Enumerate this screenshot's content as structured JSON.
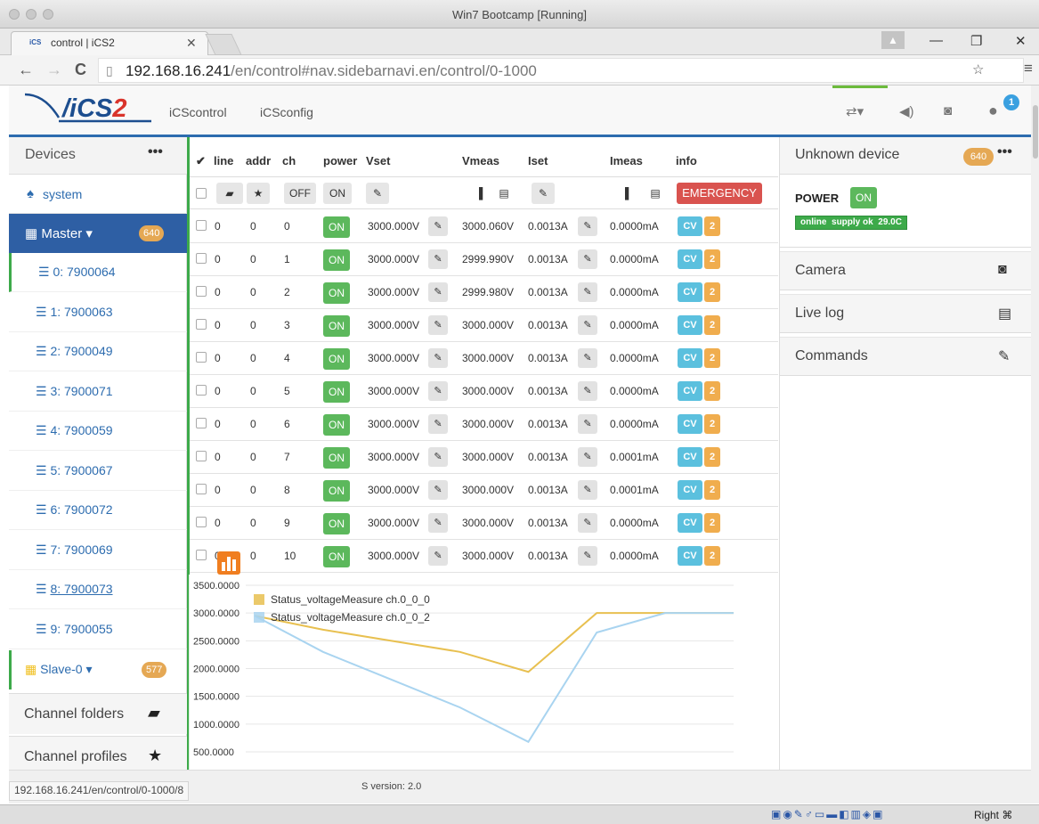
{
  "window": {
    "title": "Win7 Bootcamp [Running]"
  },
  "browser": {
    "tab_title": "control | iCS2",
    "tab_favicon": "ics2-favicon",
    "url_host": "192.168.16.241",
    "url_rest": "/en/control#nav.sidebarnavi.en/control/0-1000",
    "status_url": "192.168.16.241/en/control/0-1000/8"
  },
  "navbar": {
    "logo_prefix": "/iCS",
    "logo_suffix": "2",
    "links": [
      "iCScontrol",
      "iCSconfig"
    ],
    "notification_count": "1"
  },
  "sidebar": {
    "header": "Devices",
    "system_label": "system",
    "master_label": "Master ▾",
    "master_badge": "640",
    "channels": [
      "0: 7900064",
      "1: 7900063",
      "2: 7900049",
      "3: 7900071",
      "4: 7900059",
      "5: 7900067",
      "6: 7900072",
      "7: 7900069",
      "8: 7900073",
      "9: 7900055"
    ],
    "slave_label": "Slave-0 ▾",
    "slave_badge": "577",
    "folders_label": "Channel folders",
    "profiles_label": "Channel profiles"
  },
  "table": {
    "headers": {
      "check": "✔",
      "line": "line",
      "addr": "addr",
      "ch": "ch",
      "power": "power",
      "vset": "Vset",
      "vmeas": "Vmeas",
      "iset": "Iset",
      "imeas": "Imeas",
      "info": "info"
    },
    "controls": {
      "off": "OFF",
      "on": "ON",
      "emergency": "EMERGENCY"
    },
    "rows": [
      {
        "line": "0",
        "addr": "0",
        "ch": "0",
        "power": "ON",
        "vset": "3000.000V",
        "vmeas": "3000.060V",
        "iset": "0.0013A",
        "imeas": "0.0000mA",
        "cv": "CV",
        "n": "2"
      },
      {
        "line": "0",
        "addr": "0",
        "ch": "1",
        "power": "ON",
        "vset": "3000.000V",
        "vmeas": "2999.990V",
        "iset": "0.0013A",
        "imeas": "0.0000mA",
        "cv": "CV",
        "n": "2"
      },
      {
        "line": "0",
        "addr": "0",
        "ch": "2",
        "power": "ON",
        "vset": "3000.000V",
        "vmeas": "2999.980V",
        "iset": "0.0013A",
        "imeas": "0.0000mA",
        "cv": "CV",
        "n": "2"
      },
      {
        "line": "0",
        "addr": "0",
        "ch": "3",
        "power": "ON",
        "vset": "3000.000V",
        "vmeas": "3000.000V",
        "iset": "0.0013A",
        "imeas": "0.0000mA",
        "cv": "CV",
        "n": "2"
      },
      {
        "line": "0",
        "addr": "0",
        "ch": "4",
        "power": "ON",
        "vset": "3000.000V",
        "vmeas": "3000.000V",
        "iset": "0.0013A",
        "imeas": "0.0000mA",
        "cv": "CV",
        "n": "2"
      },
      {
        "line": "0",
        "addr": "0",
        "ch": "5",
        "power": "ON",
        "vset": "3000.000V",
        "vmeas": "3000.000V",
        "iset": "0.0013A",
        "imeas": "0.0000mA",
        "cv": "CV",
        "n": "2"
      },
      {
        "line": "0",
        "addr": "0",
        "ch": "6",
        "power": "ON",
        "vset": "3000.000V",
        "vmeas": "3000.000V",
        "iset": "0.0013A",
        "imeas": "0.0000mA",
        "cv": "CV",
        "n": "2"
      },
      {
        "line": "0",
        "addr": "0",
        "ch": "7",
        "power": "ON",
        "vset": "3000.000V",
        "vmeas": "3000.000V",
        "iset": "0.0013A",
        "imeas": "0.0001mA",
        "cv": "CV",
        "n": "2"
      },
      {
        "line": "0",
        "addr": "0",
        "ch": "8",
        "power": "ON",
        "vset": "3000.000V",
        "vmeas": "3000.000V",
        "iset": "0.0013A",
        "imeas": "0.0001mA",
        "cv": "CV",
        "n": "2"
      },
      {
        "line": "0",
        "addr": "0",
        "ch": "9",
        "power": "ON",
        "vset": "3000.000V",
        "vmeas": "3000.000V",
        "iset": "0.0013A",
        "imeas": "0.0000mA",
        "cv": "CV",
        "n": "2"
      },
      {
        "line": "0",
        "addr": "0",
        "ch": "10",
        "power": "ON",
        "vset": "3000.000V",
        "vmeas": "3000.000V",
        "iset": "0.0013A",
        "imeas": "0.0000mA",
        "cv": "CV",
        "n": "2"
      }
    ]
  },
  "right_panel": {
    "device_title": "Unknown device",
    "device_badge": "640",
    "power_label": "POWER",
    "power_state": "ON",
    "status_online": "online",
    "status_supply": "supply ok",
    "status_temp": "29.0C",
    "sections": [
      "Camera",
      "Live log",
      "Commands"
    ]
  },
  "footer": {
    "version": "S version: 2.0"
  },
  "vm": {
    "host_key": "Right ⌘"
  },
  "colors": {
    "accent": "#2d6caf",
    "on_green": "#5cb85c",
    "emergency": "#d9534f",
    "badge": "#e5a854",
    "series0": "#e8c050",
    "series1": "#a9d4f0"
  },
  "chart_data": {
    "type": "line",
    "ylim": [
      500,
      3500
    ],
    "y_ticks": [
      "3500.0000",
      "3000.0000",
      "2500.0000",
      "2000.0000",
      "1500.0000",
      "1000.0000",
      "500.0000"
    ],
    "series": [
      {
        "name": "Status_voltageMeasure ch.0_0_0",
        "values": [
          2950,
          2700,
          2500,
          2300,
          1940,
          3000,
          3000,
          3000
        ]
      },
      {
        "name": "Status_voltageMeasure ch.0_0_2",
        "values": [
          2950,
          2300,
          1800,
          1300,
          680,
          2650,
          3000,
          3000
        ]
      }
    ]
  }
}
